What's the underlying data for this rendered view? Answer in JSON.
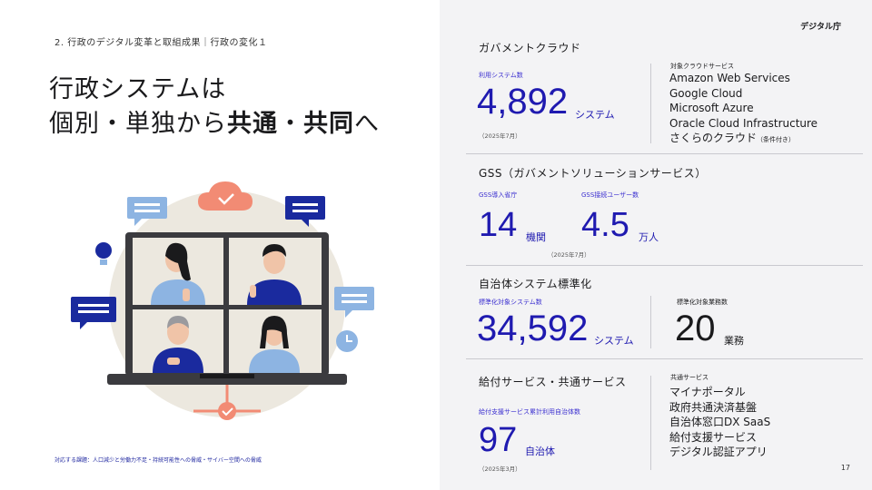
{
  "breadcrumb": "2. 行政のデジタル変革と取組成果｜行政の変化１",
  "title": {
    "line1": "行政システムは",
    "line2_pre": "個別・単独から",
    "line2_bold1": "共通",
    "line2_mid": "・",
    "line2_bold2": "共同",
    "line2_post": "へ"
  },
  "logo": "デジタル庁",
  "footnote": "対応する課題：人口減少と労働力不足・持続可能性への脅威・サイバー空間への脅威",
  "page_number": "17",
  "gov_cloud": {
    "title": "ガバメントクラウド",
    "label": "利用システム数",
    "value": "4,892",
    "unit": "システム",
    "date": "（2025年7月）",
    "services_label": "対象クラウドサービス",
    "services": [
      "Amazon Web Services",
      "Google Cloud",
      "Microsoft Azure",
      "Oracle Cloud Infrastructure",
      "さくらのクラウド"
    ],
    "services_note": "（条件付き）"
  },
  "gss": {
    "title": "GSS（ガバメントソリューションサービス）",
    "label1": "GSS導入省庁",
    "value1": "14",
    "unit1": "機関",
    "label2": "GSS接続ユーザー数",
    "value2": "4.5",
    "unit2": "万人",
    "date": "（2025年7月）"
  },
  "municipal": {
    "title": "自治体システム標準化",
    "label1": "標準化対象システム数",
    "value1": "34,592",
    "unit1": "システム",
    "label2": "標準化対象業務数",
    "value2": "20",
    "unit2": "業務"
  },
  "benefit": {
    "title": "給付サービス・共通サービス",
    "label": "給付支援サービス累計利用自治体数",
    "value": "97",
    "unit": "自治体",
    "date": "（2025年3月）",
    "services_label": "共通サービス",
    "services": [
      "マイナポータル",
      "政府共通決済基盤",
      "自治体窓口DX SaaS",
      "給付支援サービス",
      "デジタル認証アプリ"
    ]
  }
}
